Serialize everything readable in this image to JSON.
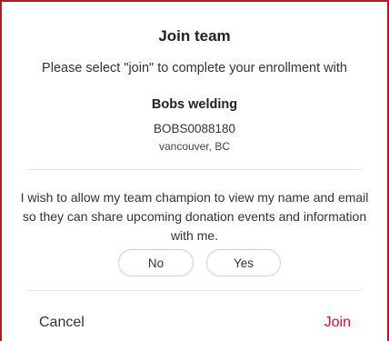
{
  "dialog": {
    "title": "Join team",
    "subtitle": "Please select \"join\" to complete your enrollment with",
    "team": {
      "name": "Bobs welding",
      "code": "BOBS0088180",
      "location": "vancouver, BC"
    },
    "consent_text": "I wish to allow my team champion to view my name and email so they can share upcoming donation events and information with me.",
    "options": {
      "no_label": "No",
      "yes_label": "Yes"
    },
    "footer": {
      "cancel_label": "Cancel",
      "join_label": "Join"
    }
  },
  "colors": {
    "accent": "#c8102e",
    "border": "#b01c25"
  }
}
